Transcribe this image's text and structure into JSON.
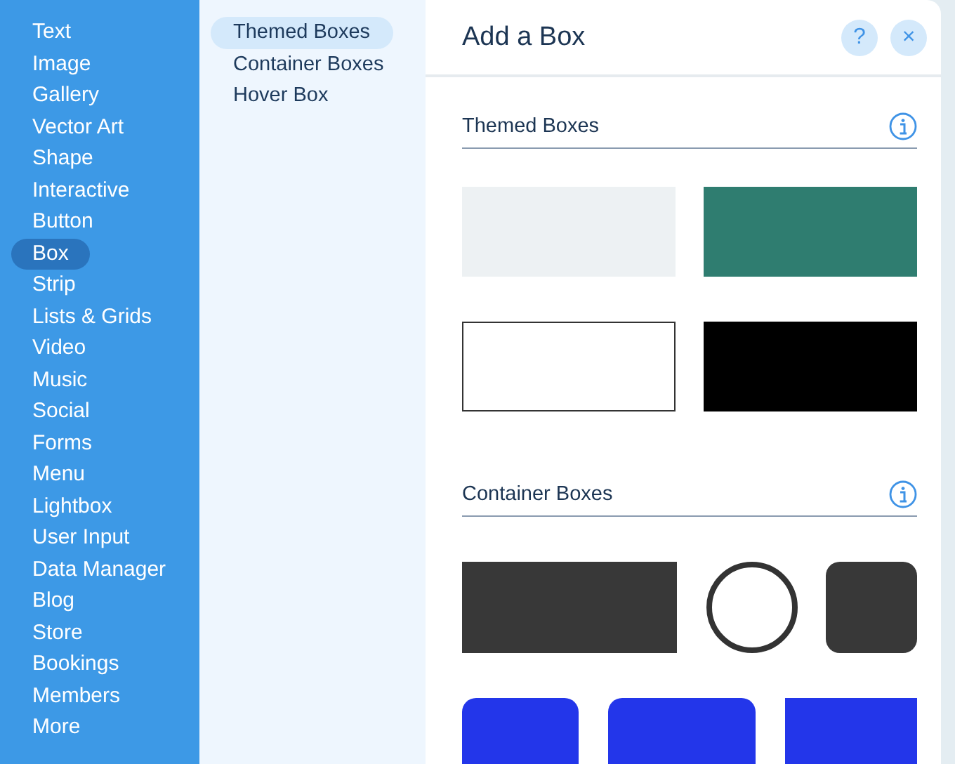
{
  "categories": [
    {
      "label": "Text",
      "selected": false
    },
    {
      "label": "Image",
      "selected": false
    },
    {
      "label": "Gallery",
      "selected": false
    },
    {
      "label": "Vector Art",
      "selected": false
    },
    {
      "label": "Shape",
      "selected": false
    },
    {
      "label": "Interactive",
      "selected": false
    },
    {
      "label": "Button",
      "selected": false
    },
    {
      "label": "Box",
      "selected": true
    },
    {
      "label": "Strip",
      "selected": false
    },
    {
      "label": "Lists & Grids",
      "selected": false
    },
    {
      "label": "Video",
      "selected": false
    },
    {
      "label": "Music",
      "selected": false
    },
    {
      "label": "Social",
      "selected": false
    },
    {
      "label": "Forms",
      "selected": false
    },
    {
      "label": "Menu",
      "selected": false
    },
    {
      "label": "Lightbox",
      "selected": false
    },
    {
      "label": "User Input",
      "selected": false
    },
    {
      "label": "Data Manager",
      "selected": false
    },
    {
      "label": "Blog",
      "selected": false
    },
    {
      "label": "Store",
      "selected": false
    },
    {
      "label": "Bookings",
      "selected": false
    },
    {
      "label": "Members",
      "selected": false
    },
    {
      "label": "More",
      "selected": false
    }
  ],
  "subcategories": [
    {
      "label": "Themed Boxes",
      "selected": true
    },
    {
      "label": "Container Boxes",
      "selected": false
    },
    {
      "label": "Hover Box",
      "selected": false
    }
  ],
  "panel": {
    "title": "Add a Box",
    "help_button": "?",
    "close_button": "×",
    "sections": [
      {
        "title": "Themed Boxes",
        "kind": "pairs",
        "tiles": [
          {
            "kind": "rect",
            "color": "#edf1f3"
          },
          {
            "kind": "rect",
            "color": "#2f7d70"
          },
          {
            "kind": "outlined",
            "color": "#ffffff"
          },
          {
            "kind": "rect",
            "color": "#000000"
          }
        ]
      },
      {
        "title": "Container Boxes",
        "kind": "rows",
        "tiles": [
          {
            "kind": "rect",
            "color": "#383838"
          },
          {
            "kind": "circle",
            "color": "#ffffff"
          },
          {
            "kind": "rounded",
            "color": "#383838"
          },
          {
            "kind": "rounded",
            "color": "#2336ea"
          },
          {
            "kind": "rounded",
            "color": "#2336ea"
          },
          {
            "kind": "rect",
            "color": "#2336ea"
          }
        ]
      }
    ]
  }
}
